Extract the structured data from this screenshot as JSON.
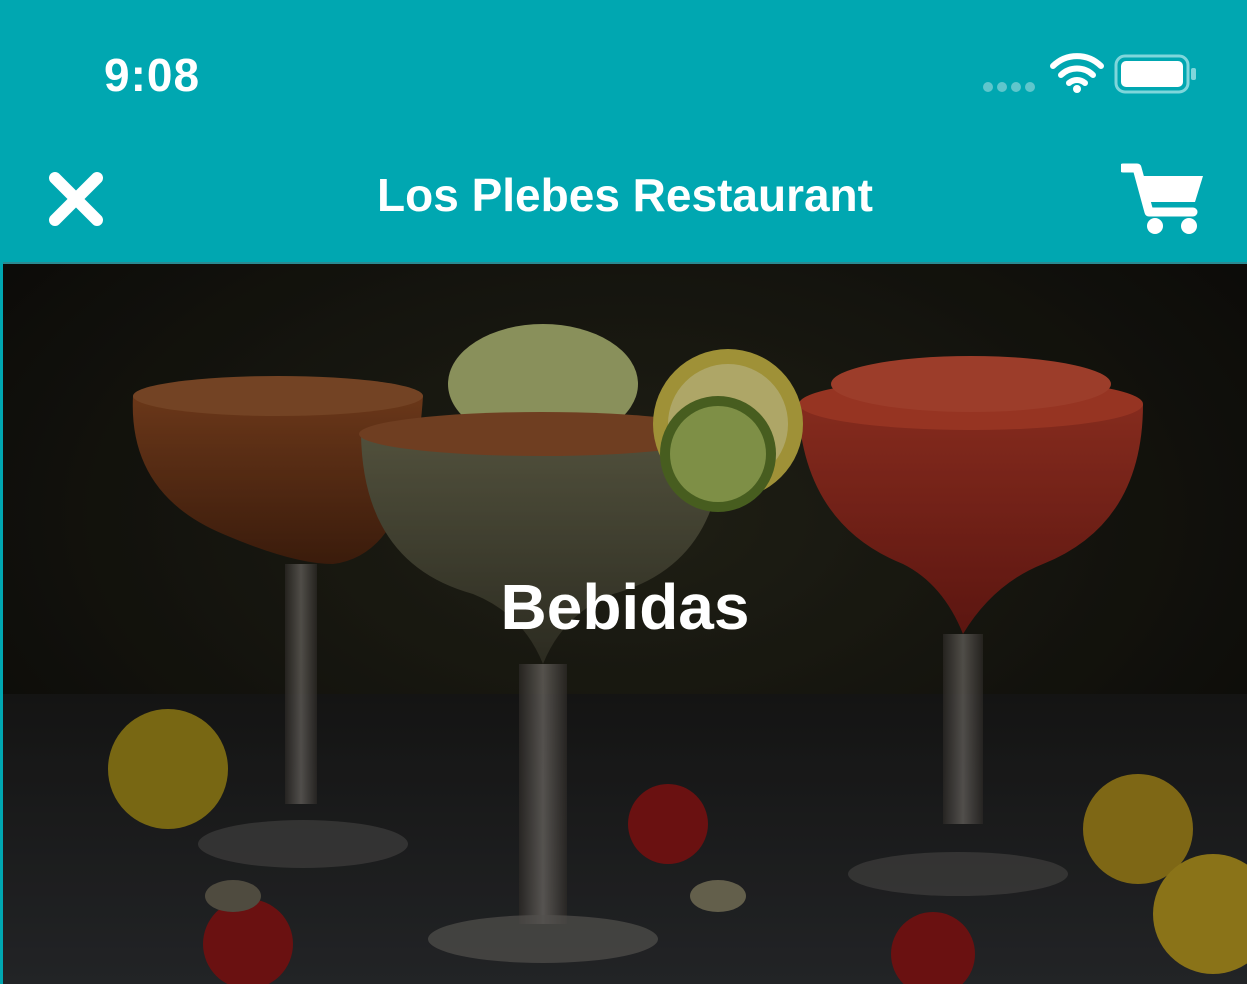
{
  "status_bar": {
    "time": "9:08",
    "icons": [
      "signal-icon",
      "wifi-icon",
      "battery-icon"
    ]
  },
  "nav_bar": {
    "title": "Los Plebes Restaurant",
    "left_icon": "close-icon",
    "right_icon": "cart-icon"
  },
  "hero": {
    "category_title": "Bebidas",
    "image_subject": "margarita-cocktails"
  },
  "colors": {
    "brand_teal": "#00a7b1",
    "text_white": "#ffffff"
  }
}
